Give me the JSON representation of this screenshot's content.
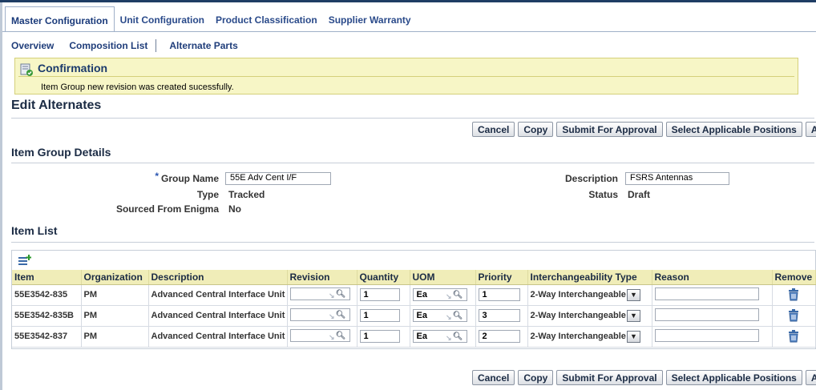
{
  "tabs": [
    {
      "label": "Master Configuration",
      "active": true
    },
    {
      "label": "Unit Configuration"
    },
    {
      "label": "Product Classification"
    },
    {
      "label": "Supplier Warranty"
    }
  ],
  "subtabs": [
    "Overview",
    "Composition List",
    "Alternate Parts"
  ],
  "confirmation": {
    "title": "Confirmation",
    "message": "Item Group new revision was created sucessfully."
  },
  "page_title": "Edit Alternates",
  "buttons": {
    "cancel": "Cancel",
    "copy": "Copy",
    "submit": "Submit For Approval",
    "select_positions": "Select Applicable Positions",
    "apply": "Apply"
  },
  "details": {
    "title": "Item Group Details",
    "group_name_label": "Group Name",
    "group_name_value": "55E Adv Cent I/F",
    "type_label": "Type",
    "type_value": "Tracked",
    "sourced_label": "Sourced From Enigma",
    "sourced_value": "No",
    "description_label": "Description",
    "description_value": "FSRS Antennas",
    "status_label": "Status",
    "status_value": "Draft"
  },
  "item_list": {
    "title": "Item List",
    "columns": [
      "Item",
      "Organization",
      "Description",
      "Revision",
      "Quantity",
      "UOM",
      "Priority",
      "Interchangeability Type",
      "Reason",
      "Remove"
    ],
    "rows": [
      {
        "item": "55E3542-835",
        "org": "PM",
        "desc": "Advanced Central Interface Unit",
        "revision": "",
        "qty": "1",
        "uom": "Ea",
        "priority": "1",
        "itype": "2-Way Interchangeable",
        "reason": ""
      },
      {
        "item": "55E3542-835B",
        "org": "PM",
        "desc": "Advanced Central Interface Unit",
        "revision": "",
        "qty": "1",
        "uom": "Ea",
        "priority": "3",
        "itype": "2-Way Interchangeable",
        "reason": ""
      },
      {
        "item": "55E3542-837",
        "org": "PM",
        "desc": "Advanced Central Interface Unit",
        "revision": "",
        "qty": "1",
        "uom": "Ea",
        "priority": "2",
        "itype": "2-Way Interchangeable",
        "reason": ""
      }
    ]
  },
  "colors": {
    "header_bg": "#f0edb8",
    "confirm_bg": "#f7f6c6",
    "link": "#1f3d7a"
  }
}
